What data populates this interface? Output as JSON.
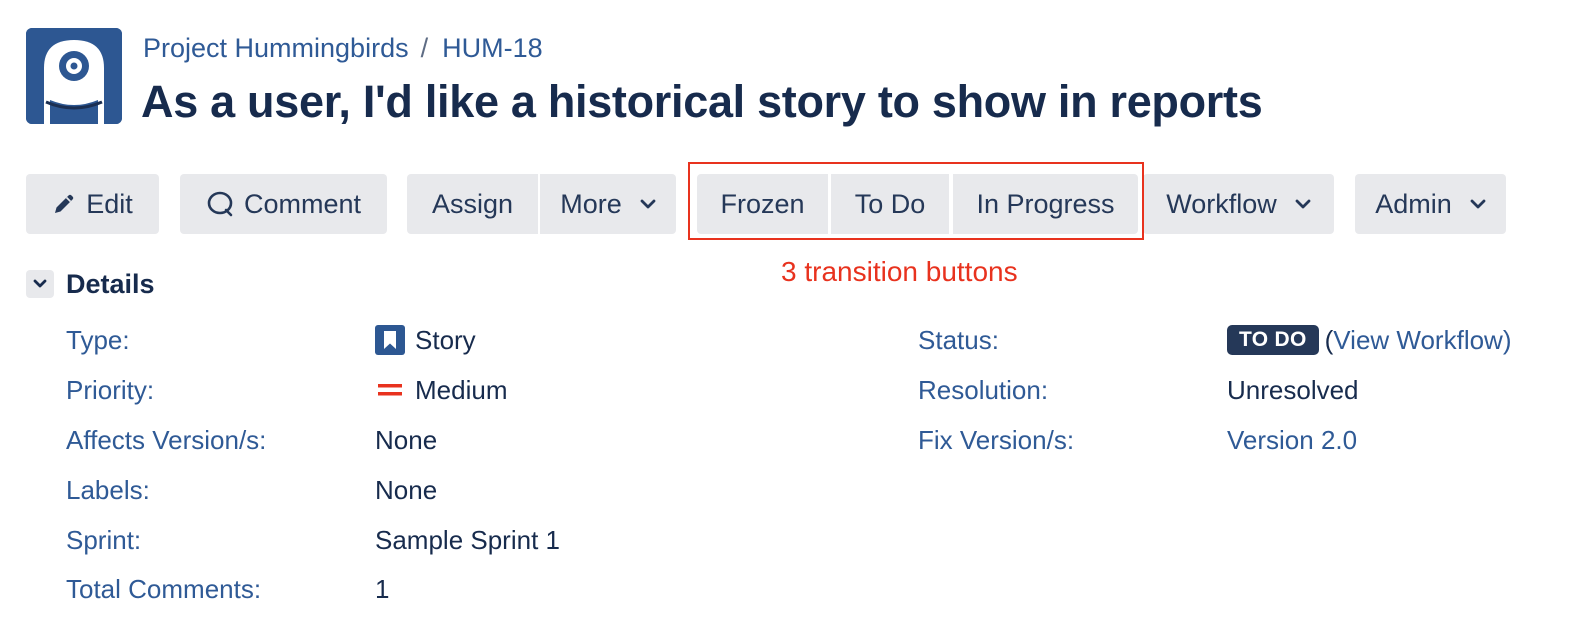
{
  "breadcrumb": {
    "project": "Project Hummingbirds",
    "separator": "/",
    "issue_key": "HUM-18"
  },
  "issue": {
    "title": "As a user, I'd like a historical story to show in reports"
  },
  "toolbar": {
    "edit": "Edit",
    "comment": "Comment",
    "assign": "Assign",
    "more": "More",
    "transitions": [
      "Frozen",
      "To Do",
      "In Progress"
    ],
    "workflow": "Workflow",
    "admin": "Admin"
  },
  "annotation": {
    "text": "3 transition buttons",
    "color": "#e8321e"
  },
  "details": {
    "heading": "Details",
    "left_fields": [
      {
        "label": "Type:",
        "value": "Story",
        "icon": "story-icon"
      },
      {
        "label": "Priority:",
        "value": "Medium",
        "icon": "priority-medium-icon"
      },
      {
        "label": "Affects Version/s:",
        "value": "None"
      },
      {
        "label": "Labels:",
        "value": "None"
      },
      {
        "label": "Sprint:",
        "value": "Sample Sprint 1"
      },
      {
        "label": "Total Comments:",
        "value": "1"
      }
    ],
    "right_fields": {
      "status_label": "Status:",
      "status_value": "TO DO",
      "status_link": "View Workflow",
      "resolution_label": "Resolution:",
      "resolution_value": "Unresolved",
      "fix_version_label": "Fix Version/s:",
      "fix_version_value": "Version 2.0"
    }
  },
  "colors": {
    "link": "#2f5a96",
    "button_bg": "#e8e9ec",
    "status_lozenge": "#253858",
    "project_avatar": "#2d5792"
  }
}
